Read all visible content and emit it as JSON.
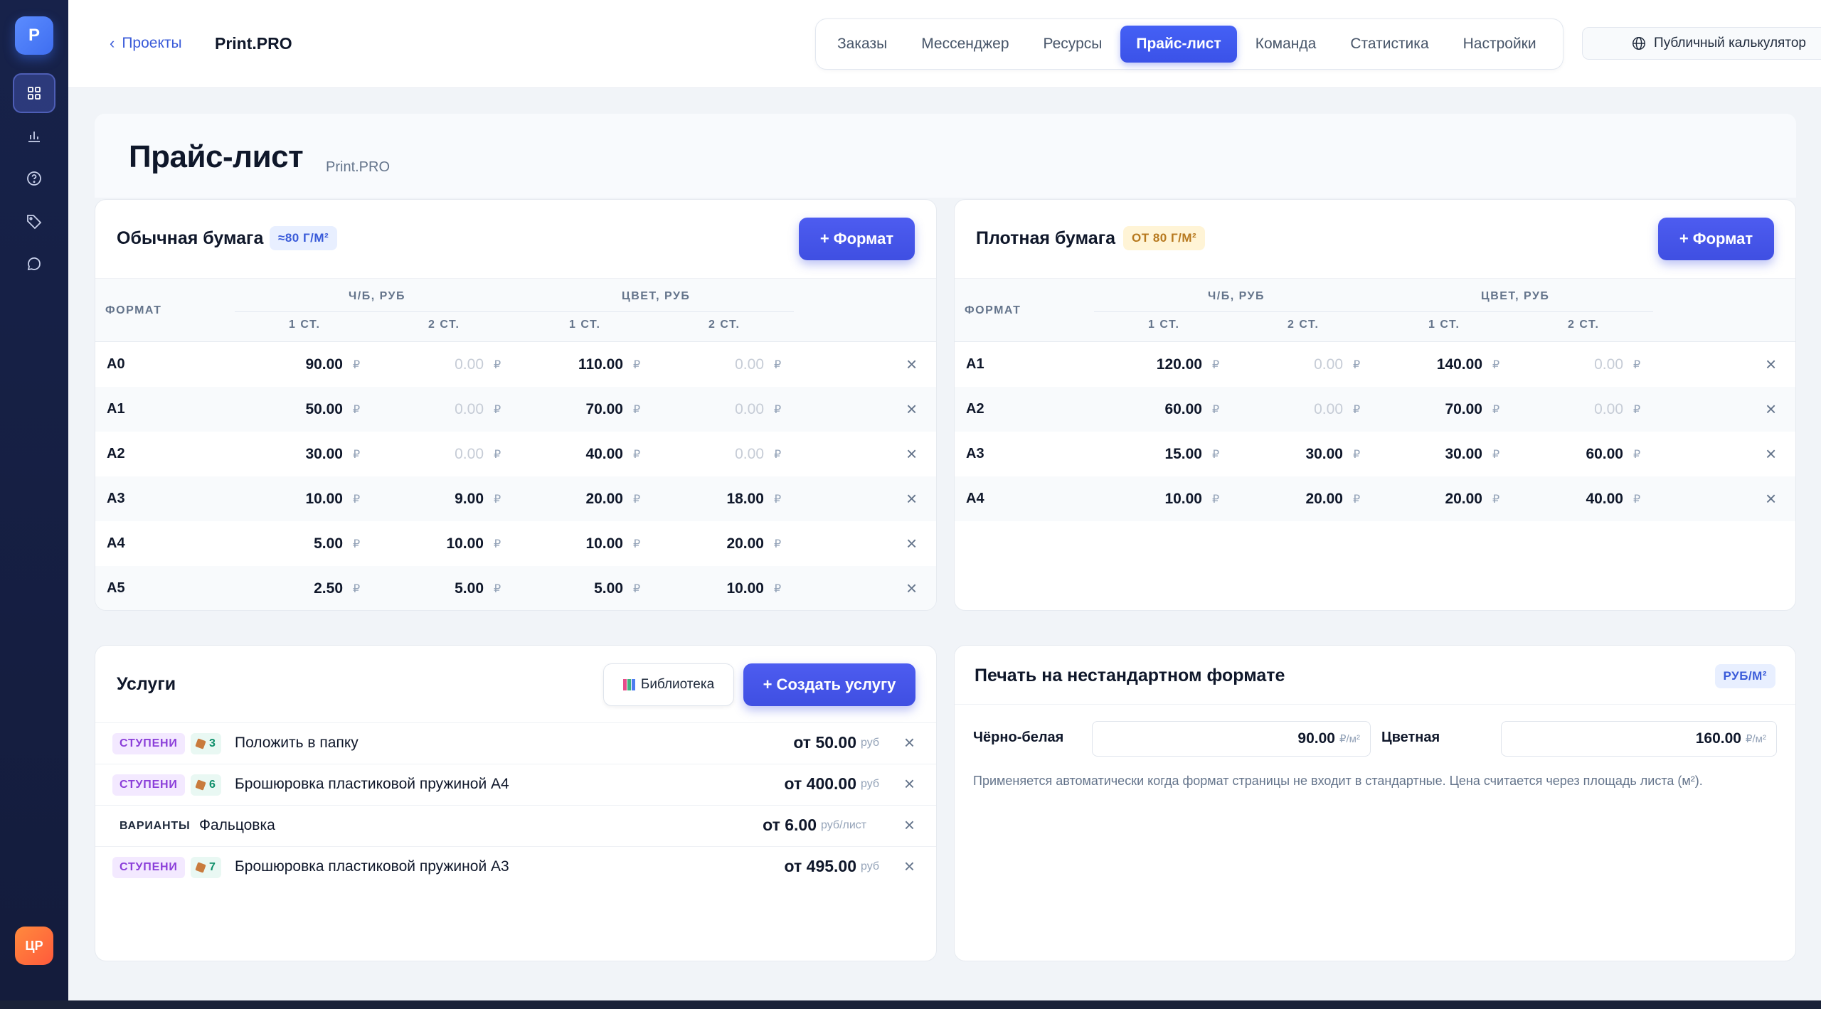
{
  "sidebar": {
    "logo": "P",
    "items": [
      {
        "name": "dashboard",
        "icon": "grid-icon",
        "active": true
      },
      {
        "name": "stats",
        "icon": "bar-chart-icon"
      },
      {
        "name": "help",
        "icon": "help-circle-icon"
      },
      {
        "name": "tags",
        "icon": "tag-icon"
      },
      {
        "name": "chat",
        "icon": "message-icon"
      }
    ],
    "avatar": "ЦР"
  },
  "header": {
    "back_label": "Проекты",
    "project_title": "Print.PRO",
    "tabs": [
      "Заказы",
      "Мессенджер",
      "Ресурсы",
      "Прайс-лист",
      "Команда",
      "Статистика",
      "Настройки"
    ],
    "active_tab": "Прайс-лист",
    "public_calc": "Публичный калькулятор"
  },
  "page": {
    "title": "Прайс-лист",
    "subtitle": "Print.PRO"
  },
  "tables": {
    "headers": {
      "format": "ФОРМАТ",
      "bw": "Ч/Б, РУБ",
      "color": "ЦВЕТ, РУБ",
      "one_side": "1 СТ.",
      "two_side": "2 СТ."
    },
    "currency": "₽",
    "add_format": "+ Формат",
    "plain": {
      "title": "Обычная бумага",
      "badge": "≈80 Г/М²",
      "rows": [
        {
          "format": "A0",
          "bw1": "90.00",
          "bw2": "0.00",
          "c1": "110.00",
          "c2": "0.00"
        },
        {
          "format": "A1",
          "bw1": "50.00",
          "bw2": "0.00",
          "c1": "70.00",
          "c2": "0.00"
        },
        {
          "format": "A2",
          "bw1": "30.00",
          "bw2": "0.00",
          "c1": "40.00",
          "c2": "0.00"
        },
        {
          "format": "A3",
          "bw1": "10.00",
          "bw2": "9.00",
          "c1": "20.00",
          "c2": "18.00"
        },
        {
          "format": "A4",
          "bw1": "5.00",
          "bw2": "10.00",
          "c1": "10.00",
          "c2": "20.00"
        },
        {
          "format": "A5",
          "bw1": "2.50",
          "bw2": "5.00",
          "c1": "5.00",
          "c2": "10.00"
        }
      ]
    },
    "dense": {
      "title": "Плотная бумага",
      "badge": "ОТ 80 Г/М²",
      "rows": [
        {
          "format": "A1",
          "bw1": "120.00",
          "bw2": "0.00",
          "c1": "140.00",
          "c2": "0.00"
        },
        {
          "format": "A2",
          "bw1": "60.00",
          "bw2": "0.00",
          "c1": "70.00",
          "c2": "0.00"
        },
        {
          "format": "A3",
          "bw1": "15.00",
          "bw2": "30.00",
          "c1": "30.00",
          "c2": "60.00"
        },
        {
          "format": "A4",
          "bw1": "10.00",
          "bw2": "20.00",
          "c1": "20.00",
          "c2": "40.00"
        }
      ]
    }
  },
  "services": {
    "title": "Услуги",
    "library": "Библиотека",
    "create": "+ Создать услугу",
    "items": [
      {
        "tag": "СТУПЕНИ",
        "tag_type": "steps",
        "count": "3",
        "name": "Положить в папку",
        "price": "от 50.00",
        "unit": "руб"
      },
      {
        "tag": "СТУПЕНИ",
        "tag_type": "steps",
        "count": "6",
        "name": "Брошюровка пластиковой пружиной А4",
        "price": "от 400.00",
        "unit": "руб"
      },
      {
        "tag": "ВАРИАНТЫ",
        "tag_type": "variants",
        "count": "",
        "name": "Фальцовка",
        "price": "от 6.00",
        "unit": "руб/лист"
      },
      {
        "tag": "СТУПЕНИ",
        "tag_type": "steps",
        "count": "7",
        "name": "Брошюровка пластиковой пружиной А3",
        "price": "от 495.00",
        "unit": "руб"
      }
    ]
  },
  "custom_format": {
    "title": "Печать на нестандартном формате",
    "badge": "РУБ/М²",
    "bw_label": "Чёрно-белая",
    "bw_value": "90.00",
    "color_label": "Цветная",
    "color_value": "160.00",
    "unit": "₽/м²",
    "note": "Применяется автоматически когда формат страницы не входит в стандартные. Цена считается через площадь листа (м²)."
  },
  "colors": {
    "accent": "#4d5cf0",
    "sidebar": "#17224a"
  }
}
